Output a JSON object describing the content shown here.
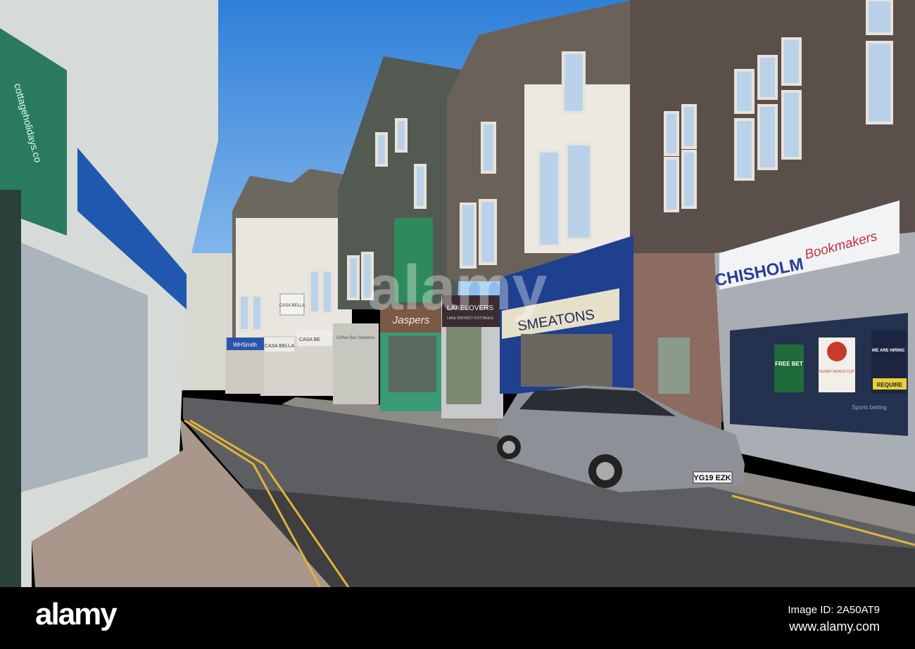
{
  "scene": {
    "description_colors": {
      "sky": "#3d8fe0",
      "road": "#5a5a5c",
      "pavement": "#9c8c80",
      "shop_blue": "#1f3f8f",
      "green_trim": "#2a8a5a",
      "car": "#8d9096"
    },
    "signs": {
      "chisholm": "CHISHOLM",
      "bookmakers": "Bookmakers",
      "smeatons": "SMEATONS",
      "lakelovers": "LAKELOVERS",
      "lakelovers_sub": "LAKE DISTRICT COTTAGES",
      "jaspers": "Jaspers",
      "casa_bella_hanging": "CASA BELLA",
      "casa_bella_fascia": "CASA BELLA",
      "casa_bella_fascia2": "CASA BE",
      "whsmith": "WHSmith",
      "coffee_bar": "Coffee Bar  Gelateria",
      "left_sign": "cottageholidays.co",
      "free_bet": "FREE BET",
      "rugby": "RUGBY WORLD CUP",
      "hiring": "WE ARE HIRING",
      "require": "REQUIRE",
      "sports_betting": "Sports betting"
    },
    "number_plate": "YG19 EZK",
    "watermark": "alamy"
  },
  "footer": {
    "logo": "alamy",
    "image_id": "Image ID: 2A50AT9",
    "url": "www.alamy.com"
  }
}
